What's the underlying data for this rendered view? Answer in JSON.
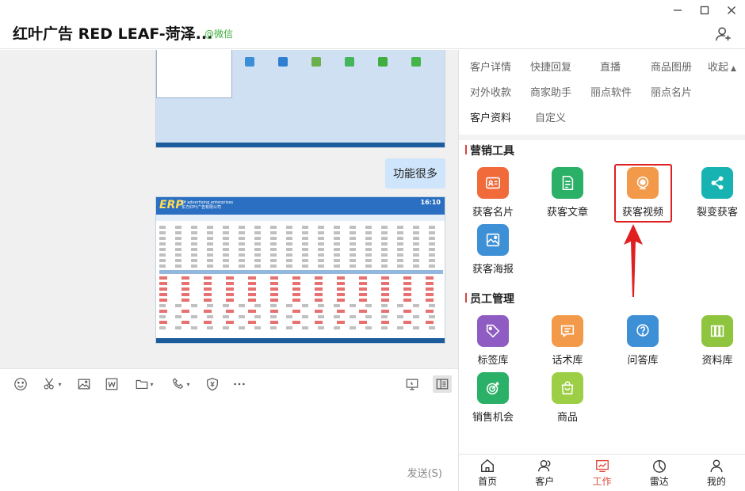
{
  "header": {
    "title": "红叶广告 RED LEAF-菏泽...",
    "wechat_tag": "@微信"
  },
  "window_controls": [
    "minimize-icon",
    "maximize-icon",
    "close-icon"
  ],
  "chat": {
    "text_message": "功能很多",
    "erp_screenshot": {
      "logo": "ERP",
      "company_en": "Of advertising enterprises",
      "company_cn": "东方红叶广告有限公司",
      "time": "16:10"
    }
  },
  "toolbar": {
    "icons": [
      "emoji-icon",
      "scissors-icon",
      "image-icon",
      "word-icon",
      "folder-icon",
      "phone-icon",
      "shield-icon",
      "more-icon",
      "screen-icon",
      "sidebar-toggle-icon"
    ],
    "send_label": "发送(S)"
  },
  "panel": {
    "menu_row1": [
      "客户详情",
      "快捷回复",
      "直播",
      "商品图册"
    ],
    "collapse_label": "收起",
    "menu_row2": [
      "对外收款",
      "商家助手",
      "丽点软件",
      "丽点名片"
    ],
    "menu_row3": [
      "客户资料",
      "自定义"
    ],
    "marketing_title": "营销工具",
    "marketing_tools": [
      {
        "label": "获客名片",
        "icon": "contact-card-icon",
        "color": "#f06a3a"
      },
      {
        "label": "获客文章",
        "icon": "article-icon",
        "color": "#2bb067"
      },
      {
        "label": "获客视频",
        "icon": "video-icon",
        "color": "#f39a4a"
      },
      {
        "label": "裂变获客",
        "icon": "share-icon",
        "color": "#17b3b3"
      },
      {
        "label": "获客海报",
        "icon": "poster-icon",
        "color": "#3d8fd6"
      }
    ],
    "staff_title": "员工管理",
    "staff_tools": [
      {
        "label": "标签库",
        "icon": "tag-icon",
        "color": "#8e5cc2"
      },
      {
        "label": "话术库",
        "icon": "chat-script-icon",
        "color": "#f39a4a"
      },
      {
        "label": "问答库",
        "icon": "question-icon",
        "color": "#3d8fd6"
      },
      {
        "label": "资料库",
        "icon": "books-icon",
        "color": "#8fc43f"
      },
      {
        "label": "销售机会",
        "icon": "target-icon",
        "color": "#2bb067"
      },
      {
        "label": "商品",
        "icon": "bag-icon",
        "color": "#9ccf45"
      }
    ]
  },
  "tabbar": {
    "tabs": [
      {
        "label": "首页",
        "icon": "home-icon"
      },
      {
        "label": "客户",
        "icon": "customers-icon"
      },
      {
        "label": "工作",
        "icon": "work-icon"
      },
      {
        "label": "雷达",
        "icon": "radar-icon"
      },
      {
        "label": "我的",
        "icon": "profile-icon"
      }
    ],
    "active_tab": "工作"
  },
  "colors": {
    "accent_red": "#e04a3d",
    "link_blue": "#2d7bd8",
    "bubble_blue": "#cfe5fb"
  }
}
